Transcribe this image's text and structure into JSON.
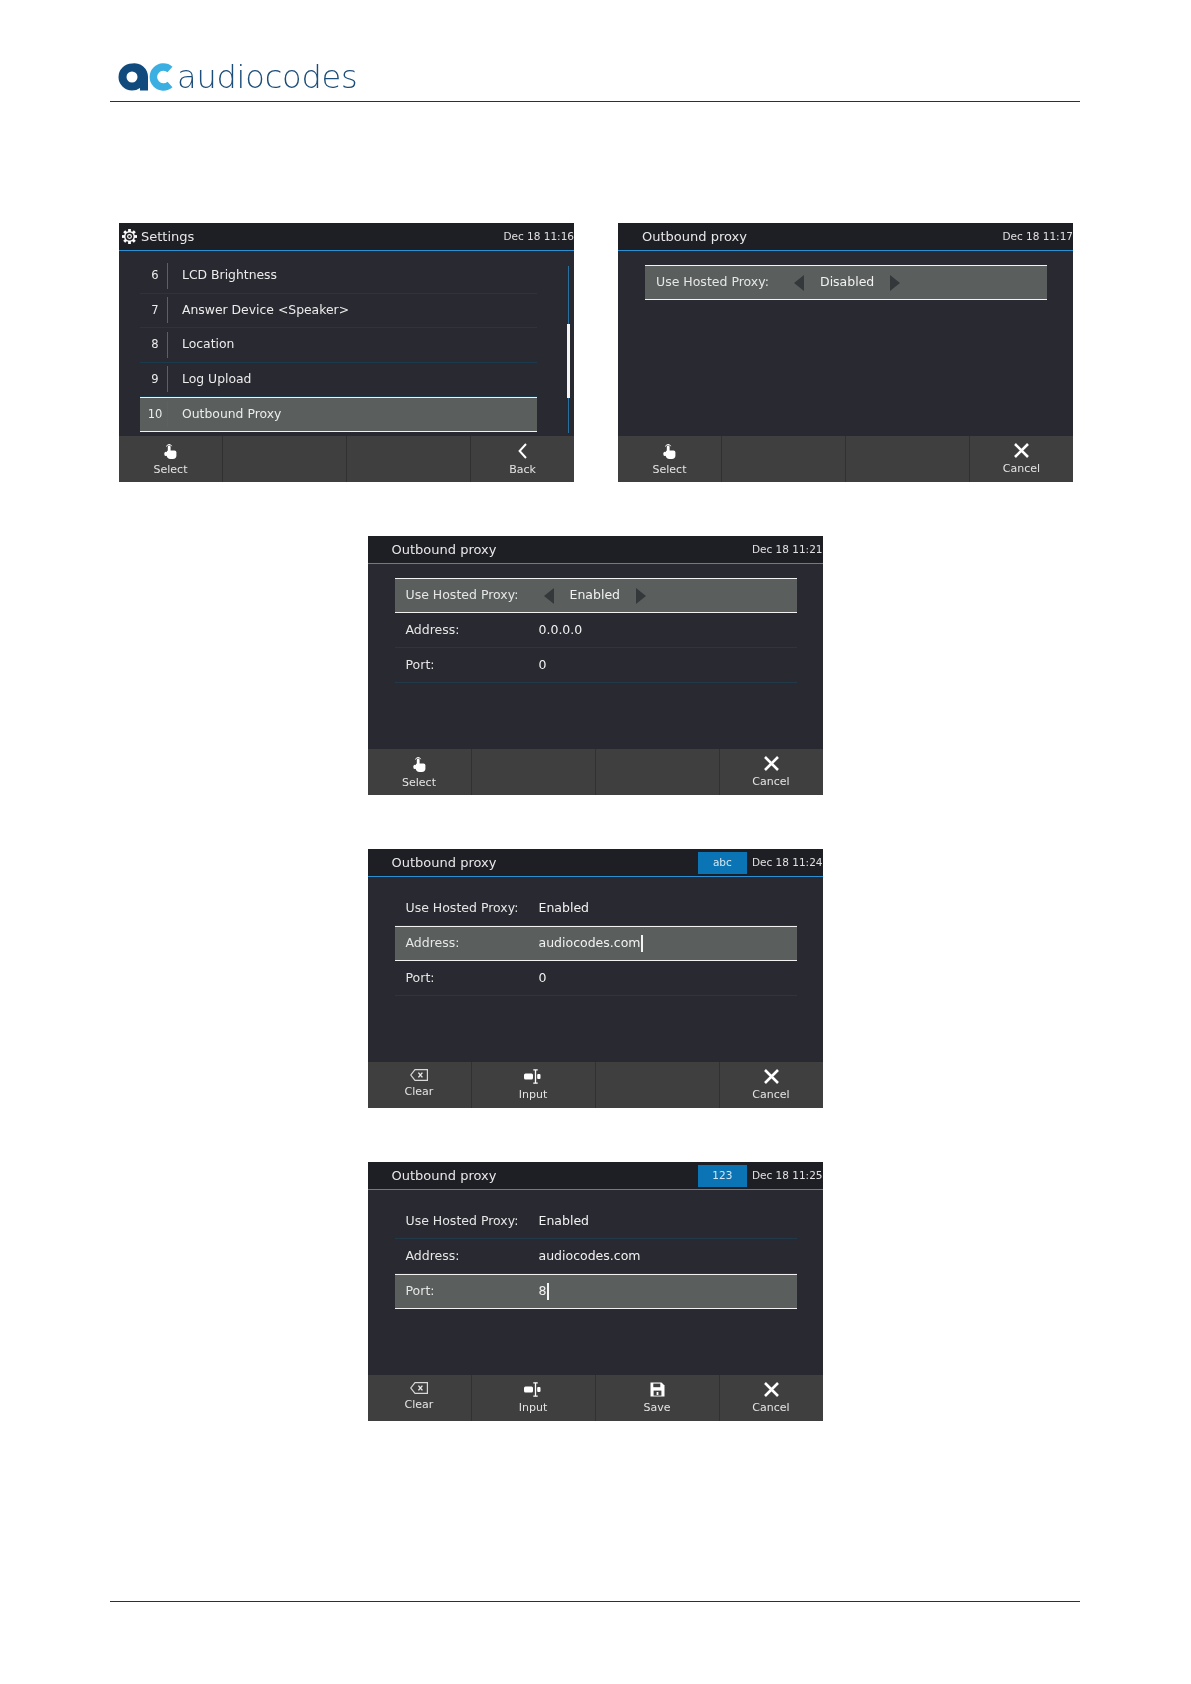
{
  "logo": {
    "wordmark": "audiocodes"
  },
  "screens": [
    {
      "kind": "menu",
      "title": "Settings",
      "date": "Dec 18 11:16",
      "items": [
        {
          "number": "6",
          "label": "LCD Brightness",
          "selected": false
        },
        {
          "number": "7",
          "label": "Answer Device <Speaker>",
          "selected": false
        },
        {
          "number": "8",
          "label": "Location",
          "selected": false
        },
        {
          "number": "9",
          "label": "Log Upload",
          "selected": false
        },
        {
          "number": "10",
          "label": "Outbound Proxy",
          "selected": true
        }
      ],
      "softkeys": [
        {
          "kind": "select",
          "label": "Select"
        },
        {
          "kind": "empty"
        },
        {
          "kind": "empty"
        },
        {
          "kind": "back",
          "label": "Back"
        }
      ]
    },
    {
      "kind": "form",
      "title": "Outbound proxy",
      "date": "Dec 18 11:17",
      "fields": [
        {
          "label": "Use Hosted Proxy:",
          "value": "Disabled",
          "selected": true,
          "arrows": true,
          "cursor": false
        }
      ],
      "softkeys": [
        {
          "kind": "select",
          "label": "Select"
        },
        {
          "kind": "empty"
        },
        {
          "kind": "empty"
        },
        {
          "kind": "cancel",
          "label": "Cancel"
        }
      ]
    },
    {
      "kind": "form",
      "title": "Outbound proxy",
      "date": "Dec 18 11:21",
      "fields": [
        {
          "label": "Use Hosted Proxy:",
          "value": "Enabled",
          "selected": true,
          "arrows": true,
          "cursor": false
        },
        {
          "label": "Address:",
          "value": "0.0.0.0",
          "selected": false,
          "arrows": false,
          "cursor": false
        },
        {
          "label": "Port:",
          "value": "0",
          "selected": false,
          "arrows": false,
          "cursor": false
        }
      ],
      "softkeys": [
        {
          "kind": "select",
          "label": "Select"
        },
        {
          "kind": "empty"
        },
        {
          "kind": "empty"
        },
        {
          "kind": "cancel",
          "label": "Cancel"
        }
      ]
    },
    {
      "kind": "form",
      "title": "Outbound proxy",
      "input_mode": "abc",
      "date": "Dec 18 11:24",
      "fields": [
        {
          "label": "Use Hosted Proxy:",
          "value": "Enabled",
          "selected": false,
          "arrows": false,
          "cursor": false
        },
        {
          "label": "Address:",
          "value": "audiocodes.com",
          "selected": true,
          "arrows": false,
          "cursor": true
        },
        {
          "label": "Port:",
          "value": "0",
          "selected": false,
          "arrows": false,
          "cursor": false
        }
      ],
      "softkeys": [
        {
          "kind": "clear",
          "label": "Clear"
        },
        {
          "kind": "input",
          "label": "Input"
        },
        {
          "kind": "empty"
        },
        {
          "kind": "cancel",
          "label": "Cancel"
        }
      ]
    },
    {
      "kind": "form",
      "title": "Outbound proxy",
      "input_mode": "123",
      "date": "Dec 18 11:25",
      "fields": [
        {
          "label": "Use Hosted Proxy:",
          "value": "Enabled",
          "selected": false,
          "arrows": false,
          "cursor": false
        },
        {
          "label": "Address:",
          "value": "audiocodes.com",
          "selected": false,
          "arrows": false,
          "cursor": false
        },
        {
          "label": "Port:",
          "value": "8",
          "selected": true,
          "arrows": false,
          "cursor": true
        }
      ],
      "softkeys": [
        {
          "kind": "clear",
          "label": "Clear"
        },
        {
          "kind": "input",
          "label": "Input"
        },
        {
          "kind": "save",
          "label": "Save"
        },
        {
          "kind": "cancel",
          "label": "Cancel"
        }
      ]
    }
  ]
}
